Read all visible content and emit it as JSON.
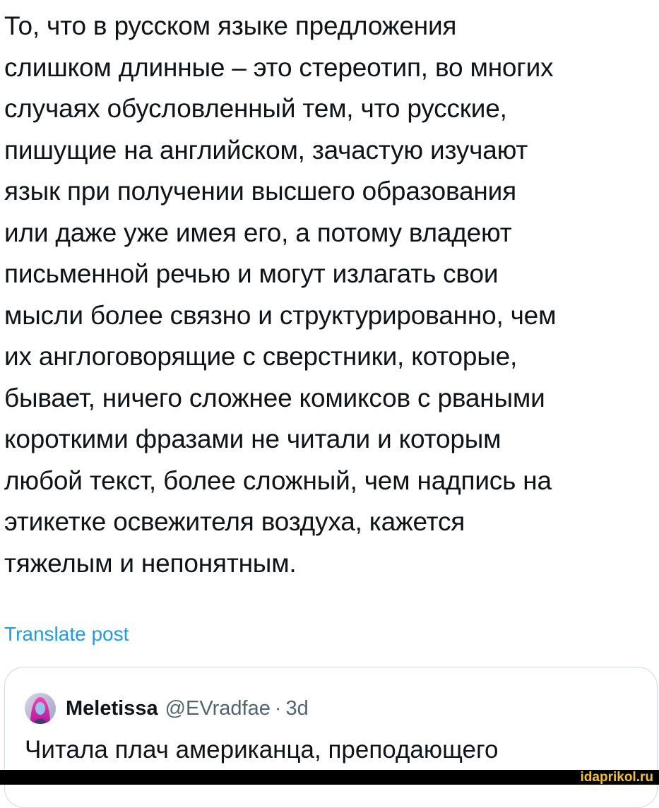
{
  "post": {
    "lines": [
      "То, что в русском языке предложения",
      "слишком длинные – это стереотип, во многих",
      "случаях обусловленный тем, что русские,",
      "пишущие на английском, зачастую изучают",
      "язык при получении высшего образования",
      "или даже уже имея его, а потому владеют",
      "письменной речью и могут излагать свои",
      "мысли более связно и структурированно, чем",
      "их англоговорящие с сверстники, которые,",
      "бывает, ничего сложнее комиксов с рваными",
      "короткими фразами не читали и которым",
      "любой текст, более сложный, чем надпись на",
      "этикетке освежителя воздуха, кажется",
      "тяжелым и непонятным."
    ],
    "translate_label": "Translate post"
  },
  "quote": {
    "author_name": "Meletissa",
    "author_handle": "@EVradfae",
    "separator": "·",
    "time": "3d",
    "text": "Читала плач американца, преподающего"
  },
  "watermark": {
    "text": "idaprikol.ru"
  },
  "colors": {
    "link": "#1d9bf0",
    "text": "#0f1419",
    "muted": "#536471",
    "border": "#cfd9de",
    "watermark": "#f5c518"
  }
}
